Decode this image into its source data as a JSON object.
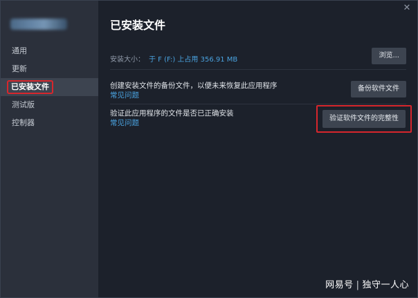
{
  "sidebar": {
    "items": [
      {
        "label": "通用"
      },
      {
        "label": "更新"
      },
      {
        "label": "已安装文件"
      },
      {
        "label": "测试版"
      },
      {
        "label": "控制器"
      }
    ],
    "active_index": 2
  },
  "header": {
    "title": "已安装文件",
    "close_glyph": "✕"
  },
  "install_size": {
    "label": "安装大小：",
    "value": "于 F (F:) 上占用 356.91 MB",
    "browse_label": "浏览..."
  },
  "backup": {
    "text": "创建安装文件的备份文件，以便未来恢复此应用程序",
    "link": "常见问题",
    "button_label": "备份软件文件"
  },
  "verify": {
    "text": "验证此应用程序的文件是否已正确安装",
    "link": "常见问题",
    "button_label": "验证软件文件的完整性"
  },
  "watermark": {
    "left": "网易号",
    "sep": "|",
    "right": "独守一人心"
  },
  "colors": {
    "accent_link": "#4aa3e0",
    "highlight_red": "#d8262c",
    "sidebar_bg": "#2b303b",
    "main_bg": "#1c212b"
  }
}
